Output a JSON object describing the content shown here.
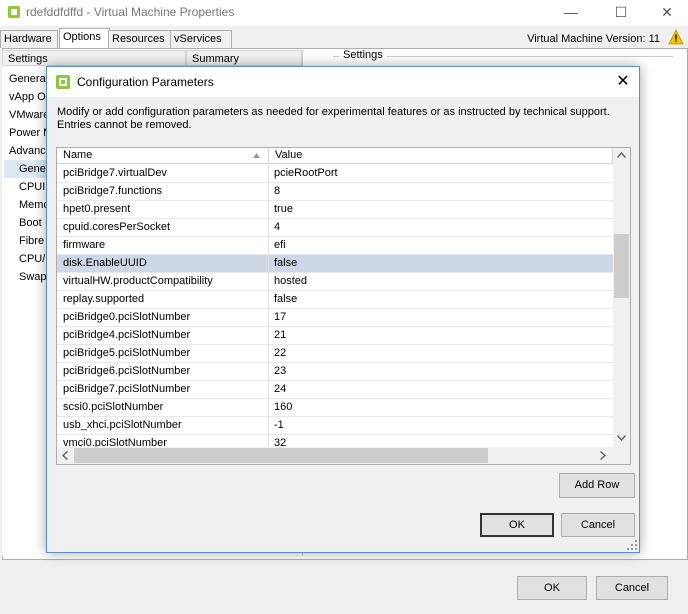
{
  "window": {
    "title": "rdefddfdffd - Virtual Machine Properties",
    "minimize": "—",
    "maximize": "☐",
    "close": "✕",
    "version_label": "Virtual Machine Version: 11"
  },
  "tabs": [
    {
      "label": "Hardware"
    },
    {
      "label": "Options"
    },
    {
      "label": "Resources"
    },
    {
      "label": "vServices"
    }
  ],
  "left_panel": {
    "headers": [
      "Settings",
      "Summary"
    ],
    "items": [
      "Genera",
      "vApp O",
      "VMware",
      "Power M",
      "Advanc",
      "Gene",
      "CPUI",
      "Memo",
      "Boot",
      "Fibre",
      "CPU/",
      "Swap"
    ],
    "selected": "Gene"
  },
  "right_group_label": "Settings",
  "dialog": {
    "title": "Configuration Parameters",
    "close": "✕",
    "description": "Modify or add configuration parameters as needed for experimental features or as instructed by technical support. Entries cannot be removed.",
    "columns": [
      "Name",
      "Value"
    ],
    "rows": [
      {
        "name": "pciBridge7.virtualDev",
        "value": "pcieRootPort"
      },
      {
        "name": "pciBridge7.functions",
        "value": "8"
      },
      {
        "name": "hpet0.present",
        "value": "true"
      },
      {
        "name": "cpuid.coresPerSocket",
        "value": "4"
      },
      {
        "name": "firmware",
        "value": "efi"
      },
      {
        "name": "disk.EnableUUID",
        "value": "false"
      },
      {
        "name": "virtualHW.productCompatibility",
        "value": "hosted"
      },
      {
        "name": "replay.supported",
        "value": "false"
      },
      {
        "name": "pciBridge0.pciSlotNumber",
        "value": "17"
      },
      {
        "name": "pciBridge4.pciSlotNumber",
        "value": "21"
      },
      {
        "name": "pciBridge5.pciSlotNumber",
        "value": "22"
      },
      {
        "name": "pciBridge6.pciSlotNumber",
        "value": "23"
      },
      {
        "name": "pciBridge7.pciSlotNumber",
        "value": "24"
      },
      {
        "name": "scsi0.pciSlotNumber",
        "value": "160"
      },
      {
        "name": "usb_xhci.pciSlotNumber",
        "value": "-1"
      },
      {
        "name": "vmci0.pciSlotNumber",
        "value": "32"
      }
    ],
    "selected_row": "disk.EnableUUID",
    "add_row_label": "Add Row",
    "ok_label": "OK",
    "cancel_label": "Cancel"
  },
  "footer": {
    "ok_label": "OK",
    "cancel_label": "Cancel"
  },
  "colors": {
    "accent": "#5a8ec9",
    "selected_row": "#cdd7e6",
    "warning": "#f5c400"
  }
}
